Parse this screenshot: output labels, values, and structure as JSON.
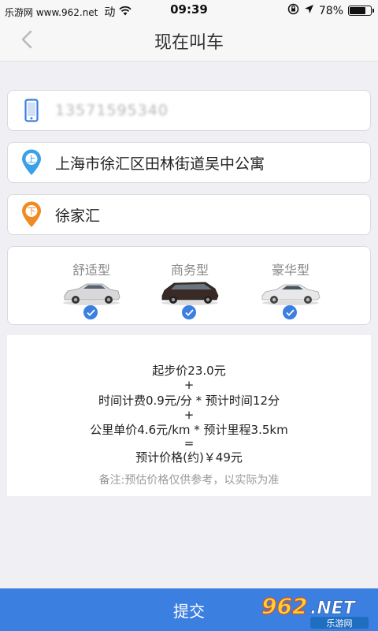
{
  "status_bar": {
    "source": "乐游网 www.962.net",
    "carrier_suffix": "动",
    "time": "09:39",
    "battery_percent": "78%",
    "battery_level": 0.78
  },
  "nav": {
    "title": "现在叫车",
    "back_icon": "chevron-left-icon"
  },
  "fields": {
    "phone": "13571595340",
    "start": "上海市徐汇区田林街道吴中公寓",
    "end": "徐家汇",
    "start_badge": "上",
    "end_badge": "下"
  },
  "car_types": [
    {
      "label": "舒适型",
      "selected": true
    },
    {
      "label": "商务型",
      "selected": true
    },
    {
      "label": "豪华型",
      "selected": true
    }
  ],
  "price": {
    "base": "起步价23.0元",
    "plus1": "+",
    "time_fee": "时间计费0.9元/分 * 预计时间12分",
    "plus2": "+",
    "distance_fee": "公里单价4.6元/km * 预计里程3.5km",
    "equals": "=",
    "estimate": "预计价格(约)￥49元",
    "note": "备注:预估价格仅供参考，以实际为准"
  },
  "submit_label": "提交",
  "watermark": {
    "number": "962",
    "suffix": ".NET",
    "subtitle": "乐游网"
  },
  "colors": {
    "accent": "#3b7fe0",
    "start_pin": "#3aa0e8",
    "end_pin": "#f08a22"
  }
}
